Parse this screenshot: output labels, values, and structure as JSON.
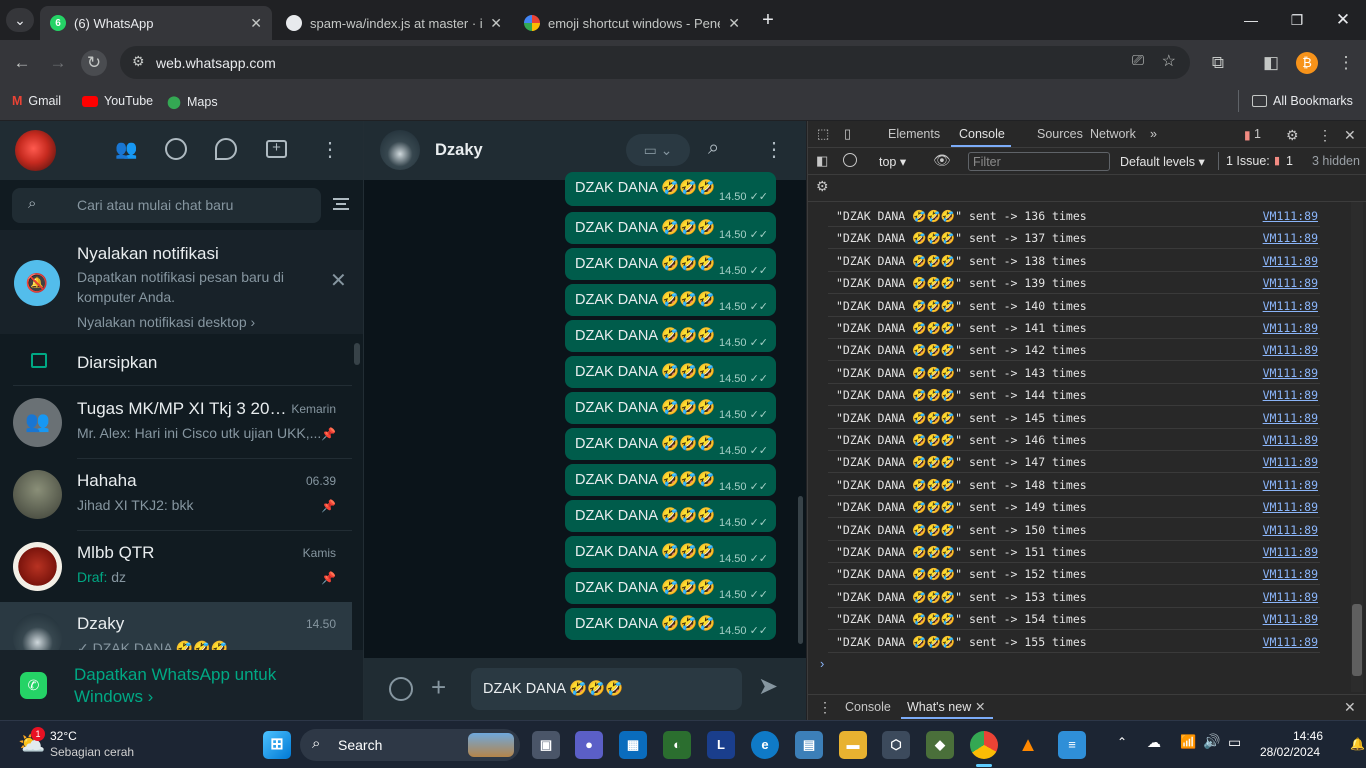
{
  "browser": {
    "tabs": [
      {
        "title": "(6) WhatsApp",
        "badge": "6"
      },
      {
        "title": "spam-wa/index.js at master · ib"
      },
      {
        "title": "emoji shortcut windows - Penel"
      }
    ],
    "url": "web.whatsapp.com",
    "bookmarks": [
      "Gmail",
      "YouTube",
      "Maps"
    ],
    "all_bookmarks": "All Bookmarks"
  },
  "whatsapp": {
    "search_placeholder": "Cari atau mulai chat baru",
    "notification": {
      "title": "Nyalakan notifikasi",
      "desc": "Dapatkan notifikasi pesan baru di komputer Anda.",
      "link": "Nyalakan notifikasi desktop ›"
    },
    "archived": "Diarsipkan",
    "chats": [
      {
        "name": "Tugas MK/MP XI Tkj 3 202...",
        "time": "Kemarin",
        "preview": "Mr. Alex: Hari ini Cisco utk ujian UKK,..."
      },
      {
        "name": "Hahaha",
        "time": "06.39",
        "preview": "Jihad XI TKJ2: bkk"
      },
      {
        "name": "Mlbb QTR",
        "time": "Kamis",
        "draft_label": "Draf:",
        "preview": " dz"
      },
      {
        "name": "Dzaky",
        "time": "14.50",
        "preview": "✓ DZAK DANA 🤣🤣🤣"
      }
    ],
    "get_app": "Dapatkan WhatsApp untuk Windows ›",
    "chat_title": "Dzaky",
    "message_text": "DZAK DANA 🤣🤣🤣",
    "message_time": "14.50",
    "composer_value": "DZAK DANA 🤣🤣🤣"
  },
  "devtools": {
    "tabs": [
      "Elements",
      "Console",
      "Sources",
      "Network"
    ],
    "error_count": "1",
    "context": "top",
    "filter_placeholder": "Filter",
    "levels": "Default levels ▾",
    "issues": "1 Issue:",
    "issue_count": "1",
    "hidden": "3 hidden",
    "log_source": "VM111:89",
    "logs": [
      "\"DZAK DANA 🤣🤣🤣\" sent -> 136 times",
      "\"DZAK DANA 🤣🤣🤣\" sent -> 137 times",
      "\"DZAK DANA 🤣🤣🤣\" sent -> 138 times",
      "\"DZAK DANA 🤣🤣🤣\" sent -> 139 times",
      "\"DZAK DANA 🤣🤣🤣\" sent -> 140 times",
      "\"DZAK DANA 🤣🤣🤣\" sent -> 141 times",
      "\"DZAK DANA 🤣🤣🤣\" sent -> 142 times",
      "\"DZAK DANA 🤣🤣🤣\" sent -> 143 times",
      "\"DZAK DANA 🤣🤣🤣\" sent -> 144 times",
      "\"DZAK DANA 🤣🤣🤣\" sent -> 145 times",
      "\"DZAK DANA 🤣🤣🤣\" sent -> 146 times",
      "\"DZAK DANA 🤣🤣🤣\" sent -> 147 times",
      "\"DZAK DANA 🤣🤣🤣\" sent -> 148 times",
      "\"DZAK DANA 🤣🤣🤣\" sent -> 149 times",
      "\"DZAK DANA 🤣🤣🤣\" sent -> 150 times",
      "\"DZAK DANA 🤣🤣🤣\" sent -> 151 times",
      "\"DZAK DANA 🤣🤣🤣\" sent -> 152 times",
      "\"DZAK DANA 🤣🤣🤣\" sent -> 153 times",
      "\"DZAK DANA 🤣🤣🤣\" sent -> 154 times",
      "\"DZAK DANA 🤣🤣🤣\" sent -> 155 times"
    ],
    "drawer_tabs": [
      "Console",
      "What's new"
    ]
  },
  "taskbar": {
    "weather_temp": "32°C",
    "weather_desc": "Sebagian cerah",
    "weather_badge": "1",
    "search_label": "Search",
    "time": "14:46",
    "date": "28/02/2024"
  },
  "colors": {
    "whatsapp_green": "#00a884",
    "bubble": "#005c4b",
    "devtools_link": "#8ab4f8"
  }
}
